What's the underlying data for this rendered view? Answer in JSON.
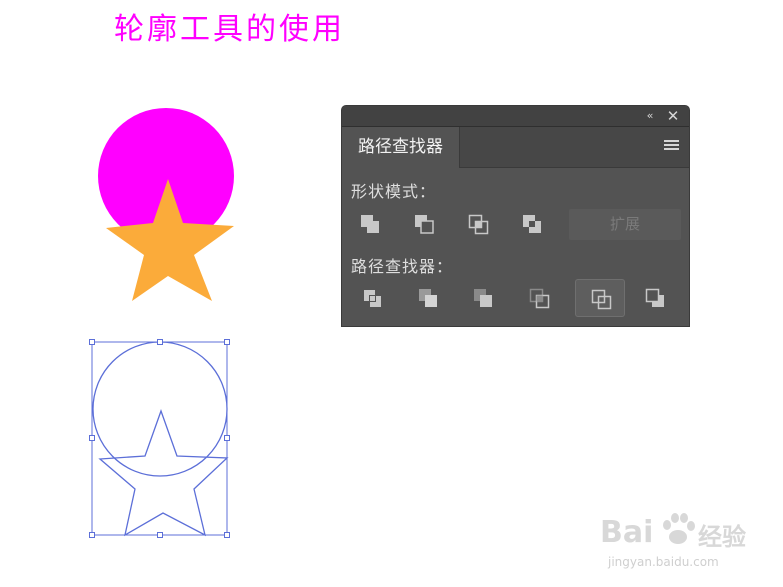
{
  "page": {
    "title": "轮廓工具的使用"
  },
  "artwork": {
    "fill_colors": {
      "circle": "#ff00ff",
      "star": "#fbab3a",
      "outline": "#5c6fd8"
    }
  },
  "pathfinder_panel": {
    "tab_label": "路径查找器",
    "collapse_label": "‹‹",
    "close_label": "✕",
    "shape_modes_label": "形状模式：",
    "pathfinders_label": "路径查找器：",
    "expand_label": "扩展",
    "shape_mode_icons": [
      "unite-icon",
      "minus-front-icon",
      "intersect-icon",
      "exclude-icon"
    ],
    "pathfinder_icons": [
      "divide-icon",
      "trim-icon",
      "merge-icon",
      "crop-icon",
      "outline-icon",
      "minus-back-icon"
    ],
    "active_icon": "outline-icon"
  },
  "watermark": {
    "brand_left": "Bai",
    "brand_right": "经验",
    "url": "jingyan.baidu.com"
  }
}
